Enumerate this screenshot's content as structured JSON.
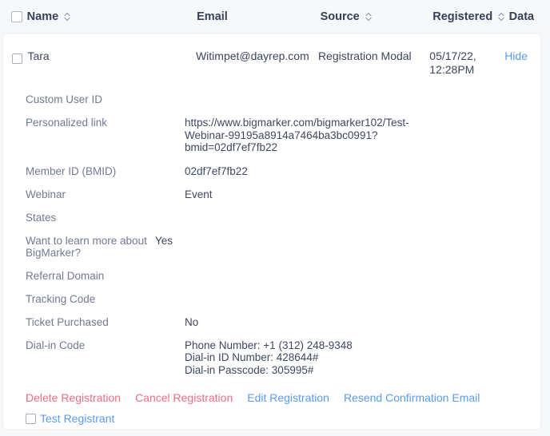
{
  "table": {
    "columns": [
      {
        "key": "checkbox",
        "label": "",
        "sortable": false
      },
      {
        "key": "name",
        "label": "Name",
        "sortable": true
      },
      {
        "key": "email",
        "label": "Email",
        "sortable": false
      },
      {
        "key": "source",
        "label": "Source",
        "sortable": true
      },
      {
        "key": "registered",
        "label": "Registered",
        "sortable": true
      },
      {
        "key": "data",
        "label": "Data",
        "sortable": false
      }
    ],
    "header": {
      "name": "Name",
      "email": "Email",
      "source": "Source",
      "registered": "Registered",
      "data": "Data"
    },
    "row": {
      "name": "Tara",
      "email": "Witimpet@dayrep.com",
      "source": "Registration Modal",
      "registered": "05/17/22,\n12:28PM",
      "hide_label": "Hide"
    }
  },
  "details": {
    "fields": [
      {
        "label": "Custom User ID",
        "value": ""
      },
      {
        "label": "Personalized link",
        "value": "https://www.bigmarker.com/bigmarker102/Test-Webinar-99195a8914a7464ba3bc0991?bmid=02df7ef7fb22"
      },
      {
        "label": "Member ID (BMID)",
        "value": "02df7ef7fb22"
      },
      {
        "label": "Webinar",
        "value": "Event"
      },
      {
        "label": "States",
        "value": ""
      },
      {
        "label": "Want to learn more about BigMarker?",
        "value": "Yes"
      },
      {
        "label": "Referral Domain",
        "value": ""
      },
      {
        "label": "Tracking Code",
        "value": ""
      },
      {
        "label": "Ticket Purchased",
        "value": "No"
      },
      {
        "label": "Dial-in Code",
        "value": "Phone Number: +1 (312) 248-9348\nDial-in ID Number: 428644#\nDial-in Passcode: 305995#"
      }
    ]
  },
  "actions": {
    "delete": "Delete Registration",
    "cancel": "Cancel Registration",
    "edit": "Edit Registration",
    "resend": "Resend Confirmation Email",
    "test_registrant": "Test Registrant"
  },
  "colors": {
    "link_blue": "#5b9bf0",
    "link_red": "#ef6d83",
    "label_text": "#717a95",
    "value_text": "#3f4862",
    "header_text": "#35405a",
    "page_background": "#f7f8fa",
    "card_background": "#ffffff"
  }
}
